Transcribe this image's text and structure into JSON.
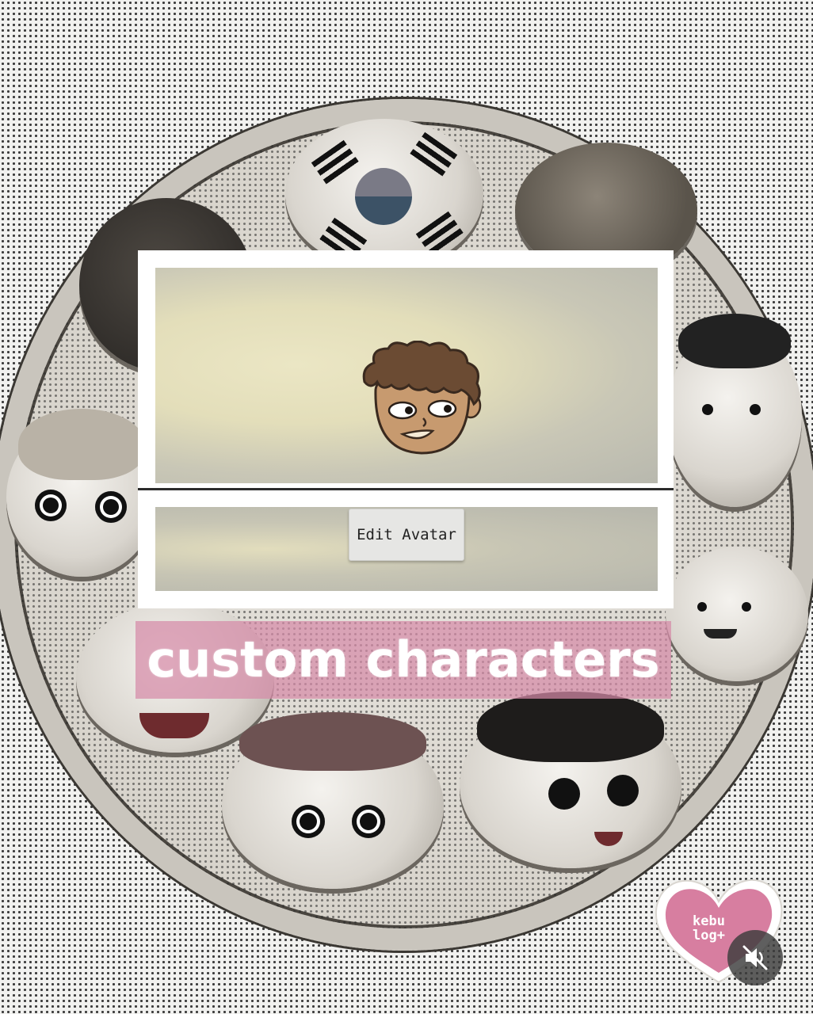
{
  "editor": {
    "edit_button_label": "Edit Avatar"
  },
  "caption": {
    "text": "custom characters"
  },
  "sticker": {
    "text": "kebu\nlog+"
  },
  "icons": {
    "mute": "speaker-muted-icon"
  },
  "colors": {
    "caption_bg": "#d68aa8",
    "sticker_pink": "#d77ea0",
    "panel_bg": "#ffffff"
  }
}
